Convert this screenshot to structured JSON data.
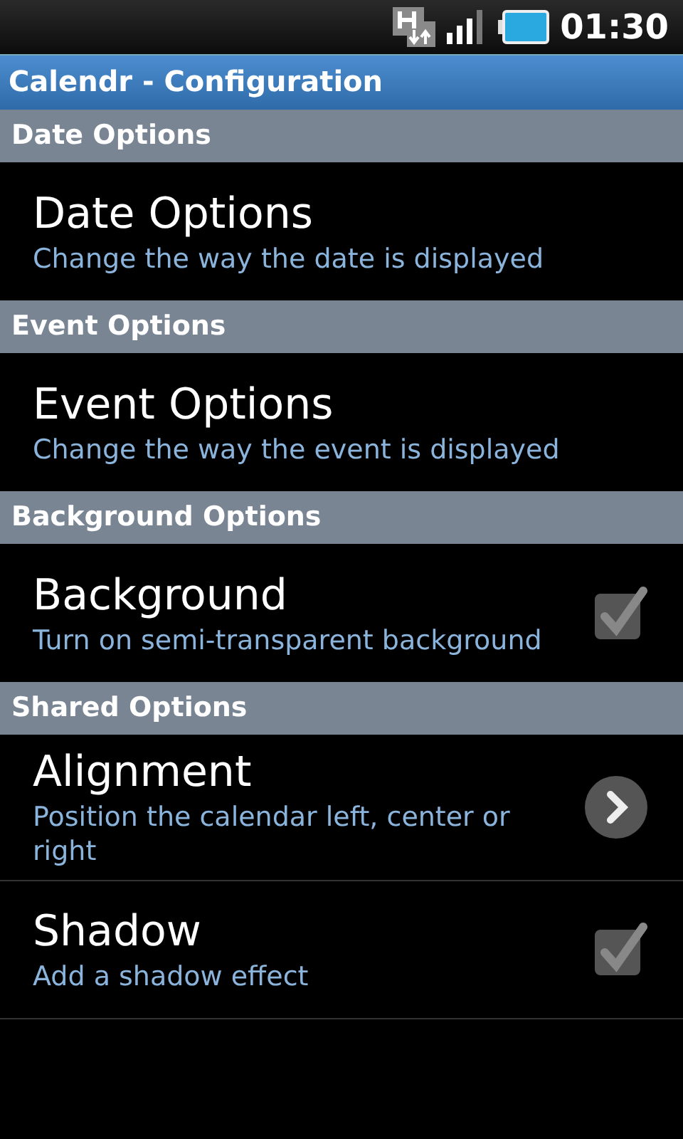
{
  "status_bar": {
    "time": "01:30"
  },
  "window": {
    "title": "Calendr - Configuration"
  },
  "sections": [
    {
      "header": "Date Options",
      "items": [
        {
          "kind": "plain",
          "title": "Date Options",
          "summary": "Change the way the date is displayed"
        }
      ]
    },
    {
      "header": "Event Options",
      "items": [
        {
          "kind": "plain",
          "title": "Event Options",
          "summary": "Change the way the event is displayed"
        }
      ]
    },
    {
      "header": "Background Options",
      "items": [
        {
          "kind": "checkbox",
          "title": "Background",
          "summary": "Turn on semi-transparent background",
          "checked": true
        }
      ]
    },
    {
      "header": "Shared Options",
      "items": [
        {
          "kind": "more",
          "title": "Alignment",
          "summary": "Position the calendar left, center or right"
        },
        {
          "kind": "checkbox",
          "title": "Shadow",
          "summary": "Add a shadow effect",
          "checked": true
        }
      ]
    }
  ]
}
